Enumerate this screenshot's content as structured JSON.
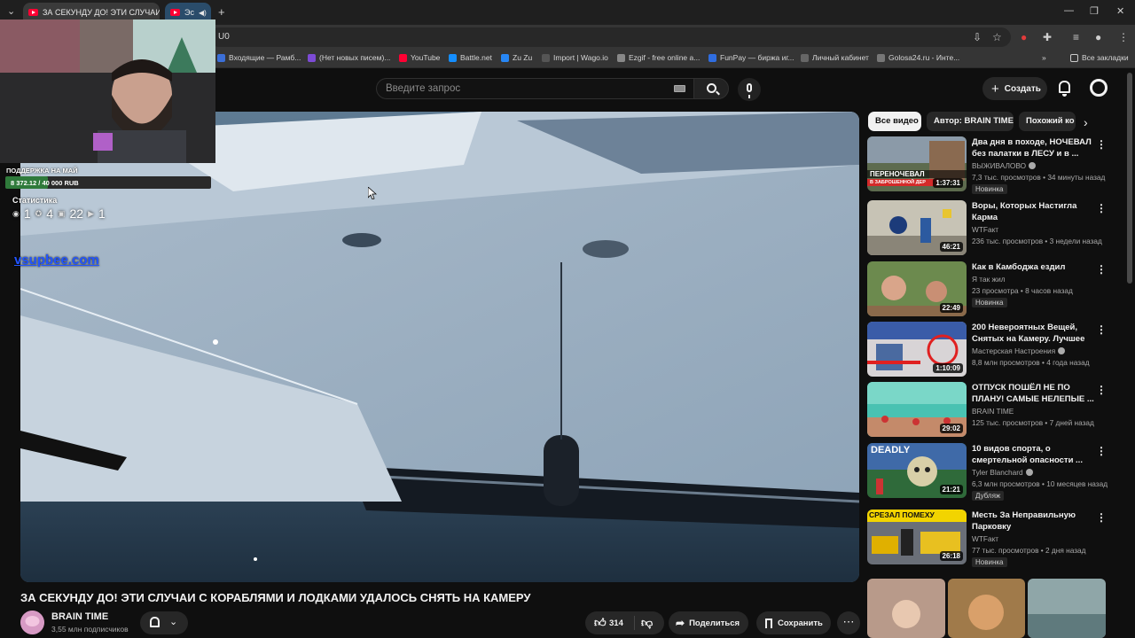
{
  "browser": {
    "tabs": [
      {
        "label": "ЗА СЕКУНДУ ДО! ЭТИ СЛУЧАИ"
      },
      {
        "label": "Эс"
      }
    ],
    "address": "U0",
    "bookmarks": [
      {
        "label": "Входящие — Рамб..."
      },
      {
        "label": "(Нет новых писем)..."
      },
      {
        "label": "YouTube"
      },
      {
        "label": "Battle.net"
      },
      {
        "label": "Zu Zu"
      },
      {
        "label": "Import | Wago.io"
      },
      {
        "label": "Ezgif - free online a..."
      },
      {
        "label": "FunPay — биржа иг..."
      },
      {
        "label": "Личный кабинет"
      },
      {
        "label": "Golosa24.ru - Инте..."
      },
      {
        "label": "Все закладки"
      }
    ],
    "bookmark_overflow": "»"
  },
  "header": {
    "search_placeholder": "Введите запрос",
    "create_label": "Создать"
  },
  "overlay": {
    "donate_title": "ПОДДЕРЖКА НА МАЙ",
    "donate_amount": "8 372.12 / 40 000 RUB",
    "donate_progress": 0.209,
    "stats_title": "Статистика",
    "stats": [
      "1",
      "4",
      "22",
      "1"
    ],
    "site": "vsupbee.com"
  },
  "video": {
    "title": "ЗА СЕКУНДУ ДО! ЭТИ СЛУЧАИ С КОРАБЛЯМИ И ЛОДКАМИ УДАЛОСЬ СНЯТЬ НА КАМЕРУ",
    "channel": "BRAIN TIME",
    "subscribers": "3,55 млн подписчиков",
    "likes": "314",
    "share_label": "Поделиться",
    "save_label": "Сохранить"
  },
  "chips": [
    "Все видео",
    "Автор: BRAIN TIME",
    "Похожий ко"
  ],
  "recommendations": [
    {
      "title": "Два дня в походе, НОЧЕВАЛ без палатки в ЛЕСУ и в ...",
      "channel": "ВЫЖИВАЛОВО",
      "meta": "7,3 тыс. просмотров • 34 минуты назад",
      "duration": "1:37:31",
      "badge": "Новинка",
      "thumb_text": "ПЕРЕНОЧЕВАЛ",
      "thumb_sub": "В ЗАБРОШЕННОЙ ДЕР"
    },
    {
      "title": "Воры, Которых Настигла Карма",
      "channel": "WTFакт",
      "meta": "236 тыс. просмотров • 3 недели назад",
      "duration": "46:21",
      "badge": ""
    },
    {
      "title": "Как в Камбоджа ездил",
      "channel": "Я так жил",
      "meta": "23 просмотра • 8 часов назад",
      "duration": "22:49",
      "badge": "Новинка"
    },
    {
      "title": "200 Невероятных Вещей, Снятых на Камеру. Лучшее з...",
      "channel": "Мастерская Настроения",
      "meta": "8,8 млн просмотров • 4 года назад",
      "duration": "1:10:09",
      "badge": ""
    },
    {
      "title": "ОТПУСК ПОШЁЛ НЕ ПО ПЛАНУ! САМЫЕ НЕЛЕПЫЕ ...",
      "channel": "BRAIN TIME",
      "meta": "125 тыс. просмотров • 7 дней назад",
      "duration": "29:02",
      "badge": ""
    },
    {
      "title": "10 видов спорта, о смертельной опасности ...",
      "channel": "Tyler Blanchard",
      "meta": "6,3 млн просмотров • 10 месяцев назад",
      "duration": "21:21",
      "badge": "Дубляж",
      "thumb_text": "DEADLY"
    },
    {
      "title": "Месть За Неправильную Парковку",
      "channel": "WTFакт",
      "meta": "77 тыс. просмотров • 2 дня назад",
      "duration": "26:18",
      "badge": "Новинка",
      "thumb_text": "СРЕЗАЛ ПОМЕХУ"
    }
  ],
  "colors": {
    "background": "#0f0f0f",
    "accent": "#ff0033",
    "chip_selected": "#f1f1f1",
    "progress_green": "#2f7a3b"
  }
}
